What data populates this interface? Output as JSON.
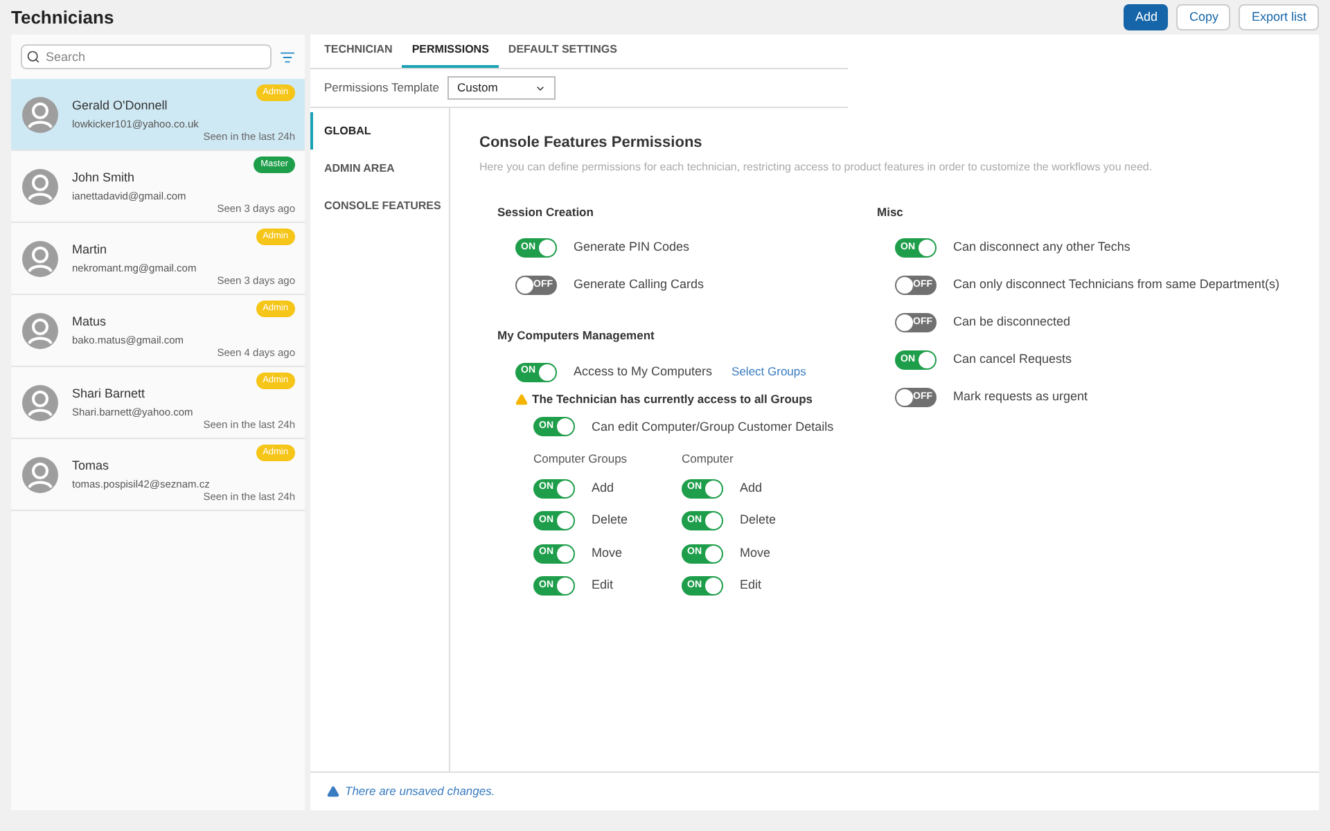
{
  "title": "Technicians",
  "header_buttons": [
    {
      "label": "Add",
      "primary": true
    },
    {
      "label": "Copy",
      "primary": false
    },
    {
      "label": "Export list",
      "primary": false
    }
  ],
  "search": {
    "placeholder": "Search"
  },
  "technicians": [
    {
      "name": "Gerald O'Donnell",
      "email": "lowkicker101@yahoo.co.uk",
      "seen": "Seen in the last 24h",
      "badge": "Admin",
      "color": "#f5c518",
      "selected": true
    },
    {
      "name": "John Smith",
      "email": "ianettadavid@gmail.com",
      "seen": "Seen 3 days ago",
      "badge": "Master",
      "color": "#1e9e4a",
      "selected": false
    },
    {
      "name": "Martin",
      "email": "nekromant.mg@gmail.com",
      "seen": "Seen 3 days ago",
      "badge": "Admin",
      "color": "#f5c518",
      "selected": false
    },
    {
      "name": "Matus",
      "email": "bako.matus@gmail.com",
      "seen": "Seen 4 days ago",
      "badge": "Admin",
      "color": "#f5c518",
      "selected": false
    },
    {
      "name": "Shari Barnett",
      "email": "Shari.barnett@yahoo.com",
      "seen": "Seen in the last 24h",
      "badge": "Admin",
      "color": "#f5c518",
      "selected": false
    },
    {
      "name": "Tomas",
      "email": "tomas.pospisil42@seznam.cz",
      "seen": "Seen in the last 24h",
      "badge": "Admin",
      "color": "#f5c518",
      "selected": false
    }
  ],
  "tabs": [
    {
      "label": "TECHNICIAN",
      "selected": false
    },
    {
      "label": "PERMISSIONS",
      "selected": true
    },
    {
      "label": "DEFAULT SETTINGS",
      "selected": false
    }
  ],
  "template": {
    "label": "Permissions Template",
    "value": "Custom"
  },
  "sections": [
    {
      "label": "GLOBAL",
      "selected": true
    },
    {
      "label": "ADMIN AREA",
      "selected": false
    },
    {
      "label": "CONSOLE FEATURES",
      "selected": false
    }
  ],
  "content": {
    "title": "Console Features Permissions",
    "description": "Here you can define permissions for each technician, restricting access to product features in order to customize the workflows you need.",
    "session_creation": {
      "heading": "Session Creation",
      "toggles": [
        {
          "label": "Generate PIN Codes",
          "on": true,
          "text": "ON"
        },
        {
          "label": "Generate Calling Cards",
          "on": false,
          "text": "OFF"
        }
      ]
    },
    "my_computers": {
      "heading": "My Computers Management",
      "access": {
        "label": "Access to My Computers",
        "on": true,
        "text": "ON",
        "link": "Select Groups"
      },
      "warning": "The Technician has currently access to all Groups",
      "edit_details": {
        "label": "Can edit Computer/Group Customer Details",
        "on": true,
        "text": "ON"
      },
      "columns": [
        {
          "heading": "Computer Groups",
          "toggles": [
            {
              "label": "Add",
              "on": true,
              "text": "ON"
            },
            {
              "label": "Delete",
              "on": true,
              "text": "ON"
            },
            {
              "label": "Move",
              "on": true,
              "text": "ON"
            },
            {
              "label": "Edit",
              "on": true,
              "text": "ON"
            }
          ]
        },
        {
          "heading": "Computer",
          "toggles": [
            {
              "label": "Add",
              "on": true,
              "text": "ON"
            },
            {
              "label": "Delete",
              "on": true,
              "text": "ON"
            },
            {
              "label": "Move",
              "on": true,
              "text": "ON"
            },
            {
              "label": "Edit",
              "on": true,
              "text": "ON"
            }
          ]
        }
      ]
    },
    "misc": {
      "heading": "Misc",
      "toggles": [
        {
          "label": "Can disconnect any other Techs",
          "on": true,
          "text": "ON"
        },
        {
          "label": "Can only disconnect Technicians from same Department(s)",
          "on": false,
          "text": "OFF"
        },
        {
          "label": "Can be disconnected",
          "on": false,
          "text": "OFF"
        },
        {
          "label": "Can cancel Requests",
          "on": true,
          "text": "ON"
        },
        {
          "label": "Mark requests as urgent",
          "on": false,
          "text": "OFF"
        }
      ]
    }
  },
  "status": "There are unsaved changes."
}
